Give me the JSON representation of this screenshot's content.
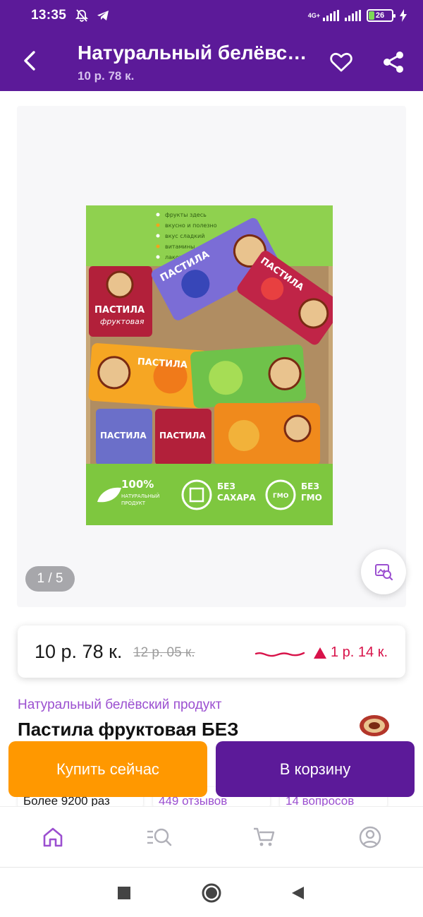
{
  "status_bar": {
    "time": "13:35",
    "network": "4G+",
    "battery": "26"
  },
  "header": {
    "title": "Натуральный белёвский продукт Пастила фруктовая БЕЗ",
    "subtitle": "10 р. 78 к."
  },
  "gallery": {
    "pager": "1 / 5",
    "image": {
      "bullets": [
        "фрукты здесь",
        "вкусно и полезно",
        "вкус сладкий",
        "витамины",
        "лакомство"
      ],
      "pastila": "ПАСТИЛА",
      "fruit": "фруктовая",
      "badges": [
        {
          "big": "100%",
          "small1": "НАТУРАЛЬНЫЙ",
          "small2": "ПРОДУКТ"
        },
        {
          "big": "БЕЗ",
          "small1": "САХАРА"
        },
        {
          "big": "БЕЗ",
          "small1": "ГМО",
          "mark": "ГМО"
        }
      ]
    }
  },
  "price": {
    "current": "10 р. 78 к.",
    "old": "12 р. 05 к.",
    "change": "1 р. 14 к.",
    "change_color": "#d8134a"
  },
  "product": {
    "brand": "Натуральный белёвский продукт",
    "title": "Пастила фруктовая БЕЗ"
  },
  "stats": {
    "bought": "Более 9200 раз",
    "reviews": "449 отзывов",
    "questions": "14 вопросов"
  },
  "actions": {
    "buy_now": "Купить сейчас",
    "add_to_cart": "В корзину"
  },
  "bottom_nav": {
    "items": [
      "home-icon",
      "catalog-search-icon",
      "cart-icon",
      "profile-icon"
    ],
    "active_color": "#9b4fd0"
  },
  "colors": {
    "brand": "#5c1a99",
    "accent": "#ff9800"
  }
}
